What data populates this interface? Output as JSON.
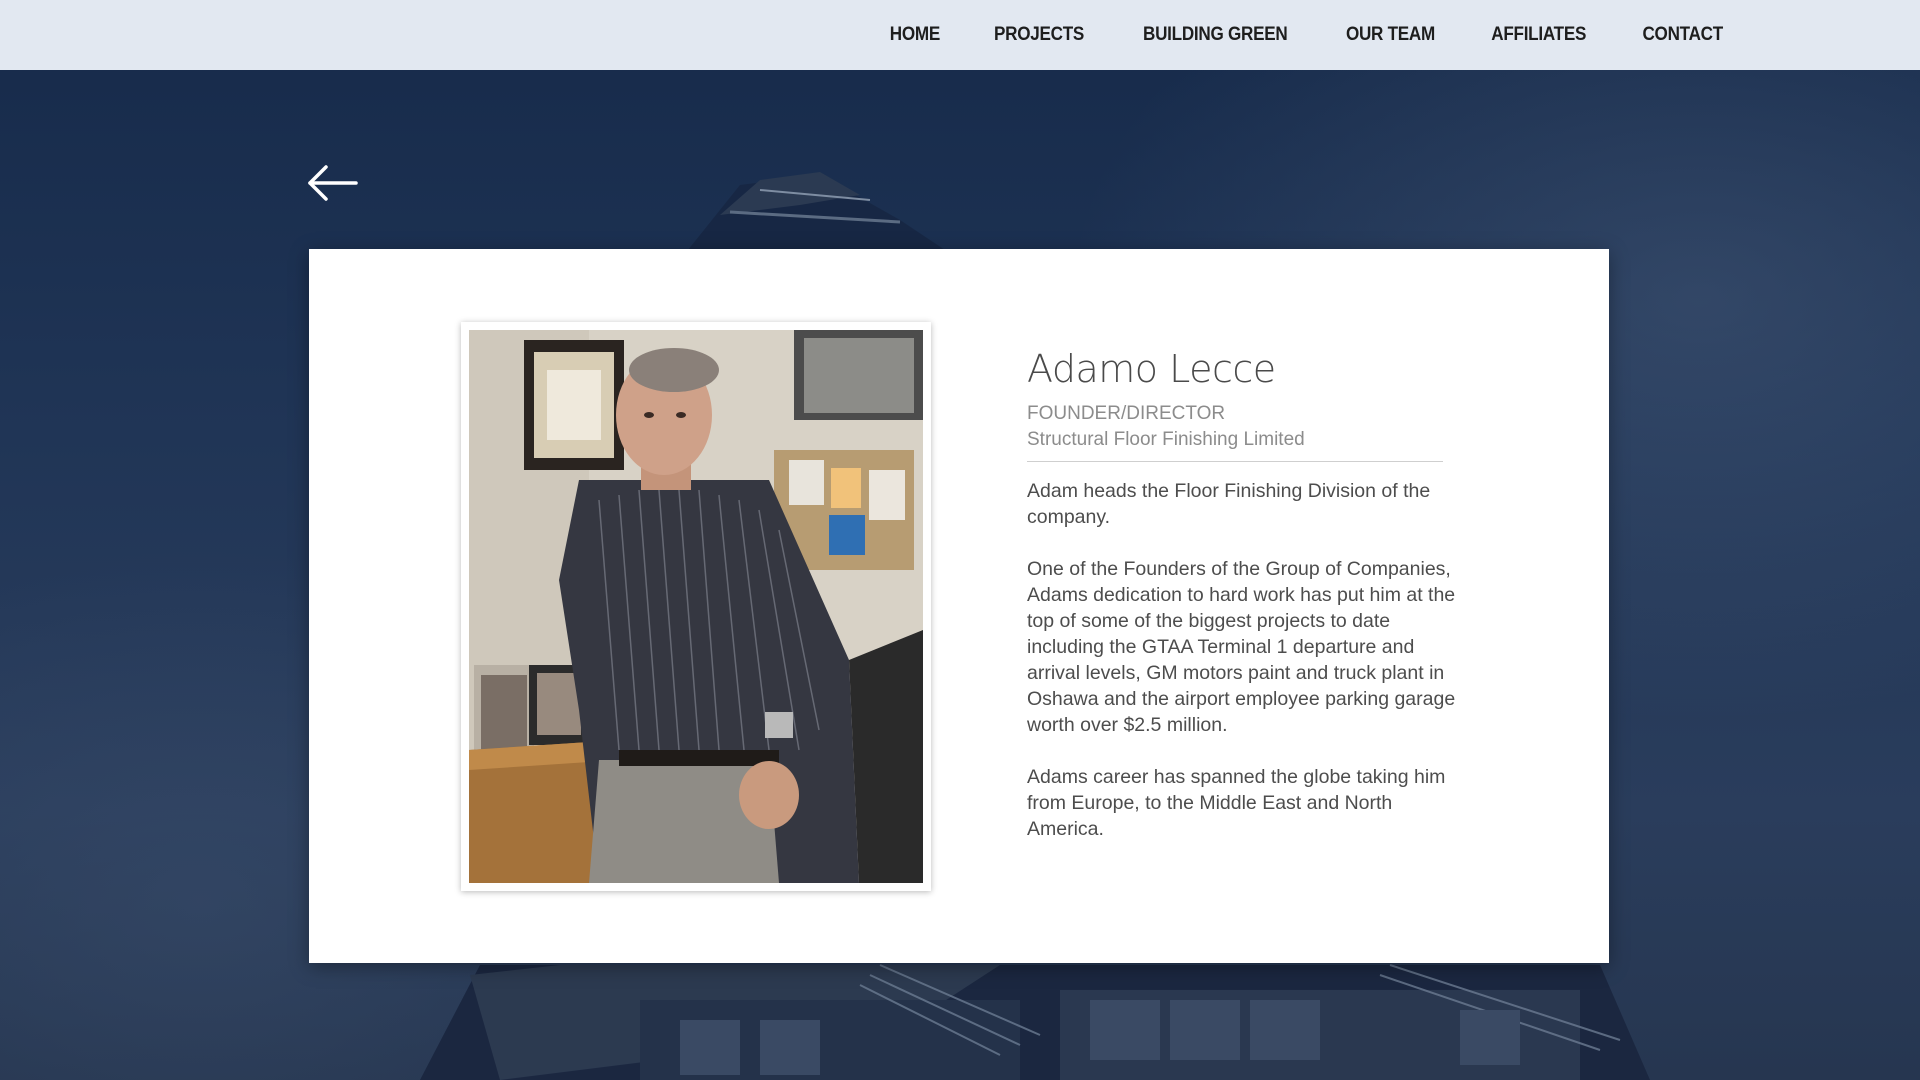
{
  "nav": {
    "items": [
      {
        "label": "HOME"
      },
      {
        "label": "PROJECTS"
      },
      {
        "label": "BUILDING GREEN"
      },
      {
        "label": "OUR TEAM"
      },
      {
        "label": "AFFILIATES"
      },
      {
        "label": "CONTACT"
      }
    ]
  },
  "back": {
    "icon": "arrow-left-icon"
  },
  "profile": {
    "name": "Adamo Lecce",
    "role": "FOUNDER/DIRECTOR",
    "company": "Structural Floor Finishing Limited",
    "bio": [
      "Adam heads the Floor Finishing Division of the company.",
      "One of the Founders of the Group of Companies, Adams dedication to hard work has put him at the top of some of the biggest projects to date including the GTAA Terminal 1 departure and arrival levels, GM motors paint and truck plant in Oshawa and the airport employee parking garage worth over $2.5 million.",
      "Adams career has spanned the globe taking him from Europe, to the Middle East and North America."
    ]
  },
  "colors": {
    "topbar": "#e2e8f1",
    "background": "#1f3150",
    "card": "#ffffff",
    "text": "#4d4d4d",
    "muted": "#8c8c8c"
  }
}
